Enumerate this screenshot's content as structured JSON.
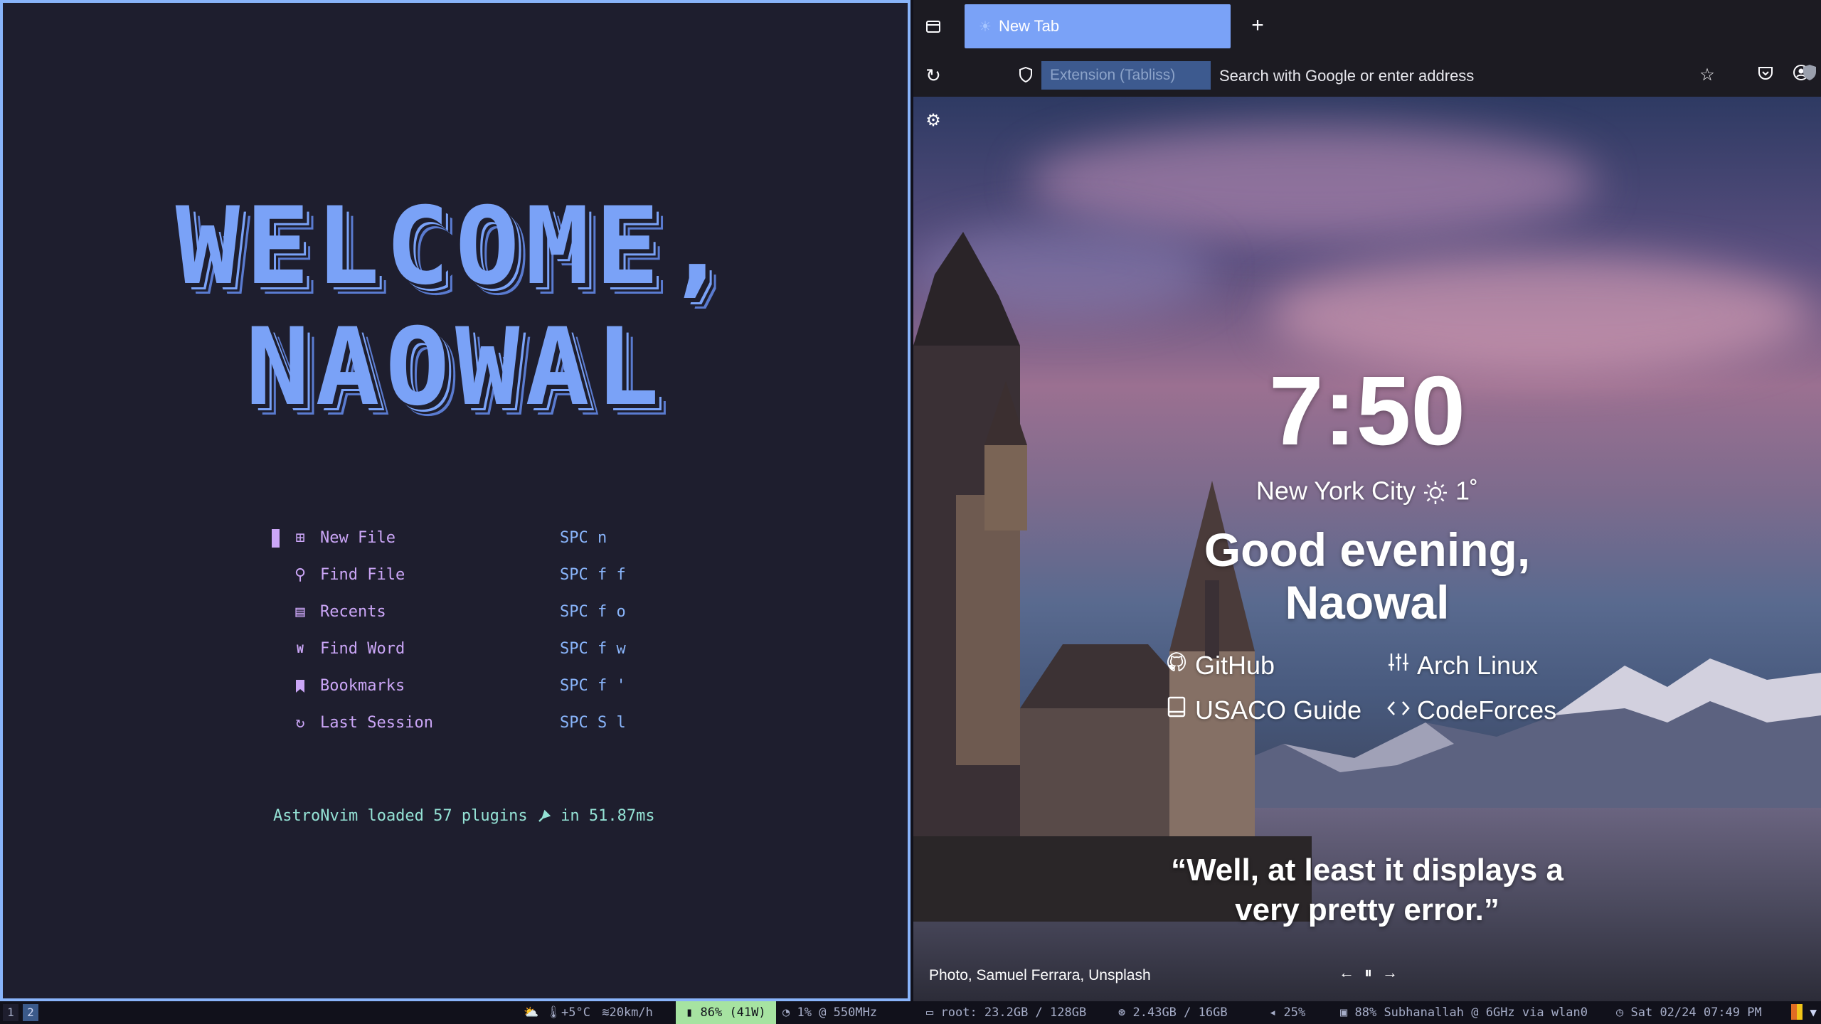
{
  "terminal": {
    "banner_lines": [
      "WELCOME,",
      "NAOWAL"
    ],
    "menu": [
      {
        "icon": "new-file-icon",
        "glyph": "⊞",
        "label": "New File",
        "key": "SPC n"
      },
      {
        "icon": "search-icon",
        "glyph": "⚲",
        "label": "Find File",
        "key": "SPC f f"
      },
      {
        "icon": "file-icon",
        "glyph": "▤",
        "label": "Recents",
        "key": "SPC f o"
      },
      {
        "icon": "word-icon",
        "glyph": "W",
        "label": "Find Word",
        "key": "SPC f w"
      },
      {
        "icon": "bookmark-icon",
        "glyph": "🔖",
        "label": "Bookmarks",
        "key": "SPC f '"
      },
      {
        "icon": "restore-icon",
        "glyph": "↻",
        "label": "Last Session",
        "key": "SPC S l"
      }
    ],
    "footer_prefix": "AstroNvim loaded 57 plugins",
    "footer_suffix": "in 51.87ms"
  },
  "browser": {
    "tab_title": "New Tab",
    "extension_badge": "Extension (Tabliss)",
    "url_placeholder": "Search with Google or enter address",
    "clock": "7:50",
    "city": "New York City",
    "temperature": "1˚",
    "greeting_line1": "Good evening,",
    "greeting_line2": "Naowal",
    "links": [
      {
        "label": "GitHub",
        "icon": "github-icon"
      },
      {
        "label": "Arch Linux",
        "icon": "sliders-icon"
      },
      {
        "label": "USACO Guide",
        "icon": "book-icon"
      },
      {
        "label": "CodeForces",
        "icon": "code-icon"
      }
    ],
    "quote_line1": "“Well, at least it displays a",
    "quote_line2": "very pretty error.”",
    "photo_credit": "Photo, Samuel Ferrara, Unsplash"
  },
  "statusbar": {
    "workspaces": [
      "1",
      "2"
    ],
    "weather": "+5°C",
    "wind": "20km/h",
    "battery": "86% (41W)",
    "cpu": "1% @ 550MHz",
    "disk": "root: 23.2GB / 128GB",
    "memory": "2.43GB / 16GB",
    "volume": "25%",
    "wifi": "88% Subhanallah @ 6GHz via wlan0",
    "datetime": "Sat 02/24 07:49 PM"
  },
  "colors": {
    "accent": "#89b4fa",
    "banner": "#7aa2f7",
    "menu_text": "#cba6f7",
    "footer_text": "#94e2d5",
    "tab_active": "#7aa2f7",
    "battery_bg": "#a6e3a1"
  }
}
